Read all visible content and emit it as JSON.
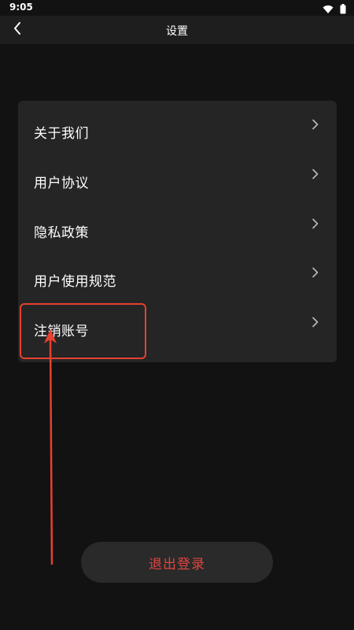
{
  "status_bar": {
    "time": "9:05",
    "icons": [
      "wifi-icon",
      "battery-icon"
    ]
  },
  "header": {
    "title": "设置",
    "back_icon": "chevron-left-icon"
  },
  "menu": {
    "items": [
      {
        "label": "关于我们"
      },
      {
        "label": "用户协议"
      },
      {
        "label": "隐私政策"
      },
      {
        "label": "用户使用规范"
      },
      {
        "label": "注销账号"
      }
    ],
    "chevron_icon": "chevron-right-icon"
  },
  "logout": {
    "label": "退出登录",
    "color": "#e0453f"
  },
  "annotation": {
    "highlighted_item": "注销账号",
    "color": "#e8402f"
  },
  "colors": {
    "background": "#121212",
    "card": "#252525",
    "app_bar": "#1e1e1e",
    "text": "#ffffff"
  }
}
